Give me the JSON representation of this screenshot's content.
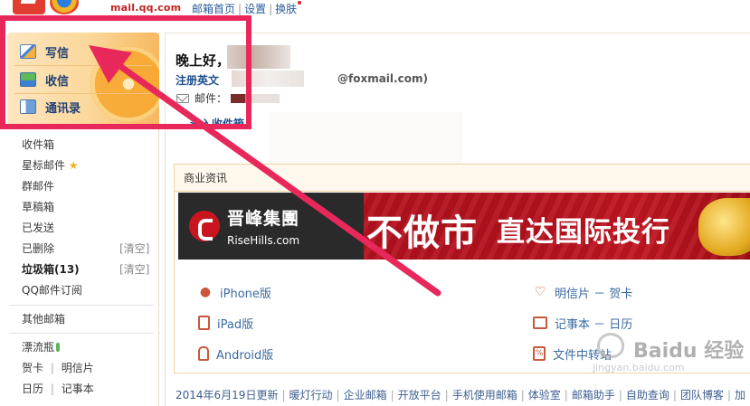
{
  "topbar": {
    "mail_url": "mail.qq.com",
    "links": [
      "邮箱首页",
      "设置",
      "换肤"
    ],
    "separator": "|"
  },
  "write_panel": {
    "compose_label": "写信",
    "inbox_label": "收信",
    "contacts_label": "通讯录"
  },
  "folders": {
    "inbox": "收件箱",
    "starred": "星标邮件",
    "star_glyph": "★",
    "group": "群邮件",
    "drafts": "草稿箱",
    "sent": "已发送",
    "deleted": "已删除",
    "deleted_clear": "[清空]",
    "spam": "垃圾箱(13)",
    "spam_clear": "[清空]",
    "qq_subscription": "QQ邮件订阅",
    "other_mailbox": "其他邮箱",
    "drift_bottle": "漂流瓶",
    "greeting_card": "贺卡",
    "postcard": "明信片",
    "calendar": "日历",
    "notebook": "记事本",
    "separator": "|"
  },
  "main": {
    "greeting": "晚上好，",
    "register_prefix": "注册英文",
    "foxmail_suffix": "@foxmail.com)",
    "mailbox_label": "邮件：",
    "inbox_link": "进入收件箱"
  },
  "news": {
    "header": "商业资讯",
    "banner": {
      "company_cn": "晋峰集團",
      "company_en": "RiseHills.com",
      "slogan_1": "不做市",
      "slogan_2": "直达国际投行"
    },
    "apps": {
      "iphone": "iPhone版",
      "ipad": "iPad版",
      "android": "Android版",
      "postcard": "明信片 － 贺卡",
      "notebook": "记事本 － 日历",
      "file_transfer": "文件中转站"
    }
  },
  "footer": {
    "items": [
      "2014年6月19日更新",
      "暖灯行动",
      "企业邮箱",
      "开放平台",
      "手机使用邮箱",
      "体验室",
      "邮箱助手",
      "自助查询",
      "团队博客",
      "加"
    ]
  },
  "watermark": {
    "text": "Baidu 经验",
    "sub": "jingyan.baidu.com"
  },
  "colors": {
    "highlight": "#e8285a",
    "link": "#1e4f8c",
    "banner_red": "#b4121f"
  }
}
